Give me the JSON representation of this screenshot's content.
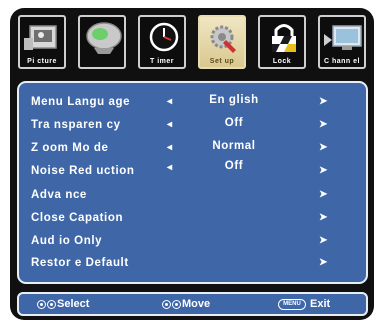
{
  "tabs": [
    {
      "label": "Pi cture",
      "icon": "picture-icon",
      "active": false
    },
    {
      "label": "",
      "icon": "sound-icon",
      "active": false
    },
    {
      "label": "T imer",
      "icon": "timer-clock-icon",
      "active": false
    },
    {
      "label": "Set up",
      "icon": "setup-gear-icon",
      "active": true
    },
    {
      "label": "Lock",
      "icon": "lock-icon",
      "active": false
    },
    {
      "label": "C hann el",
      "icon": "channel-tv-icon",
      "active": false
    }
  ],
  "menu": [
    {
      "label": "Menu Langu age",
      "value": "En glish",
      "left_arrow": true
    },
    {
      "label": "Tra nsparen cy",
      "value": "Off",
      "left_arrow": true
    },
    {
      "label": "Z oom Mo de",
      "value": "Normal",
      "left_arrow": true
    },
    {
      "label": "Noise Red uction",
      "value": "Off",
      "left_arrow": true
    },
    {
      "label": "Adva nce",
      "value": "",
      "left_arrow": false
    },
    {
      "label": "Close Capation",
      "value": "",
      "left_arrow": false
    },
    {
      "label": "Aud io Only",
      "value": "",
      "left_arrow": false
    },
    {
      "label": "Restor e Default",
      "value": "",
      "left_arrow": false
    }
  ],
  "help": {
    "select_label": "Select",
    "move_label": "Move",
    "menu_key": "MENU",
    "exit_label": "Exit"
  },
  "colors": {
    "panel": "#3f67a8",
    "frame": "#101010",
    "active_tab": "#e6d7a4"
  }
}
